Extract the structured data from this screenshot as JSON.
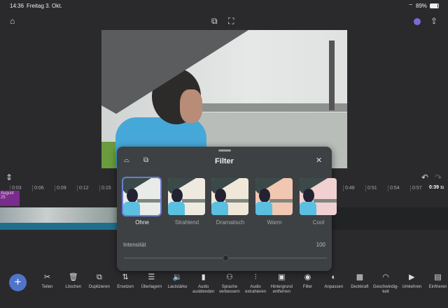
{
  "status": {
    "time": "14:36",
    "date": "Freitag 3. Okt.",
    "battery": "89%"
  },
  "timeline": {
    "ticks": [
      "0:03",
      "0:06",
      "0:09",
      "0:12",
      "0:15",
      "0:48",
      "0:51",
      "0:54",
      "0:57"
    ],
    "current": "0:39",
    "current_frames": "11",
    "clip_label": "August 25"
  },
  "panel": {
    "title": "Filter",
    "filters": [
      {
        "label": "Ohne",
        "tint": "#e9ebe8"
      },
      {
        "label": "Strahlend",
        "tint": "#eeeae0"
      },
      {
        "label": "Dramatisch",
        "tint": "#efe8d8"
      },
      {
        "label": "Warm",
        "tint": "#f2c7b2"
      },
      {
        "label": "Cool",
        "tint": "#f0d0d0"
      }
    ],
    "selected": "Ohne",
    "intensity_label": "Intensität",
    "intensity_value": "100",
    "intensity_fraction": 0.5
  },
  "toolbar": [
    {
      "label": "Teilen",
      "icon": "✂"
    },
    {
      "label": "Löschen",
      "icon": "🗑"
    },
    {
      "label": "Duplizieren",
      "icon": "⧉"
    },
    {
      "label": "Ersetzen",
      "icon": "⇅"
    },
    {
      "label": "Überlagern",
      "icon": "☰"
    },
    {
      "label": "Lautstärke",
      "icon": "🔉"
    },
    {
      "label": "Audio ausblenden",
      "icon": "▮"
    },
    {
      "label": "Sprache verbessern",
      "icon": "⚇"
    },
    {
      "label": "Audio extrahieren",
      "icon": "⫶"
    },
    {
      "label": "Hintergrund entfernen",
      "icon": "▣"
    },
    {
      "label": "Filter",
      "icon": "◉"
    },
    {
      "label": "Anpassen",
      "icon": "◐"
    },
    {
      "label": "Deckkraft",
      "icon": "▩"
    },
    {
      "label": "Geschwindig-keit",
      "icon": "◠"
    },
    {
      "label": "Umkehren",
      "icon": "▶"
    },
    {
      "label": "Einfrieren",
      "icon": "▤"
    }
  ]
}
